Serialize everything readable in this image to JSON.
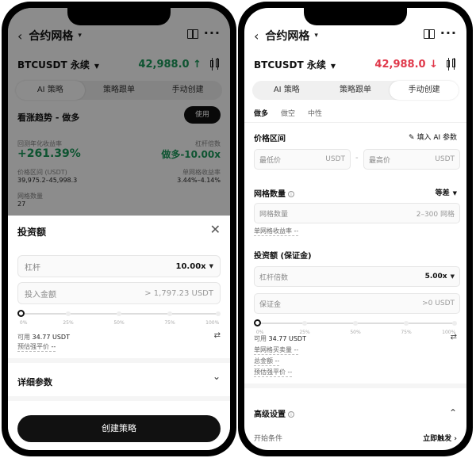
{
  "left": {
    "header": {
      "back": "‹",
      "title": "合约网格",
      "caret": "▾",
      "more": "···"
    },
    "pair": {
      "name": "BTCUSDT 永续",
      "price": "42,988.0 ↑"
    },
    "tabs": [
      "AI 策略",
      "策略跟单",
      "手动创建"
    ],
    "card": {
      "strategy": "看涨趋势 - 做多",
      "use_label": "使用",
      "annual_label": "回测年化收益率",
      "annual_value": "+261.39%",
      "leverage_label": "杠杆倍数",
      "leverage_value": "做多-10.00x",
      "range_label": "价格区间 (USDT)",
      "range_value": "39,975.2–45,998.3",
      "per_grid_label": "单网格收益率",
      "per_grid_value": "3.44%–4.14%",
      "grid_count_label": "网格数量",
      "grid_count_value": "27"
    },
    "sheet": {
      "title": "投资额",
      "close": "✕",
      "leverage_label": "杠杆",
      "leverage_value": "10.00x",
      "amount_label": "投入金额",
      "amount_value": "> 1,797.23 USDT",
      "ticks": [
        "0%",
        "25%",
        "50%",
        "75%",
        "100%"
      ],
      "available_label": "可用",
      "available_value": "34.77 USDT",
      "liq_label": "预估强平价",
      "liq_value": "--",
      "swap_icon": "⇄",
      "detail_label": "详细参数",
      "chevron": "⌄",
      "create_button": "创建策略"
    }
  },
  "right": {
    "header": {
      "back": "‹",
      "title": "合约网格",
      "caret": "▾",
      "more": "···"
    },
    "pair": {
      "name": "BTCUSDT 永续",
      "price": "42,988.0 ↓"
    },
    "tabs": [
      "AI 策略",
      "策略跟单",
      "手动创建"
    ],
    "subtabs": [
      "做多",
      "做空",
      "中性"
    ],
    "range_label": "价格区间",
    "fill_ai": "填入 AI 参数",
    "min_price": "最低价",
    "max_price": "最高价",
    "unit": "USDT",
    "dash": "-",
    "grid_count_label": "网格数量",
    "mode_label": "等差",
    "grid_count_placeholder": "网格数量",
    "grid_count_range": "2–300 网格",
    "per_grid_note": "单网格收益率 --",
    "invest_label": "投资额 (保证金)",
    "leverage_label": "杠杆倍数",
    "leverage_value": "5.00x",
    "margin_label": "保证金",
    "margin_value": ">0 USDT",
    "ticks": [
      "0%",
      "25%",
      "50%",
      "75%",
      "100%"
    ],
    "available_label": "可用",
    "available_value": "34.77 USDT",
    "swap_icon": "⇄",
    "per_grid_buy": "单网格买卖量 --",
    "total": "总金额 --",
    "liq": "预估强平价 --",
    "advanced_label": "高级设置",
    "start_label": "开始条件",
    "start_value": "立即触发 ›",
    "chevron_up": "⌃"
  },
  "colors": {
    "up": "#1a9a5a",
    "down": "#e0384a",
    "accent": "#111111"
  }
}
